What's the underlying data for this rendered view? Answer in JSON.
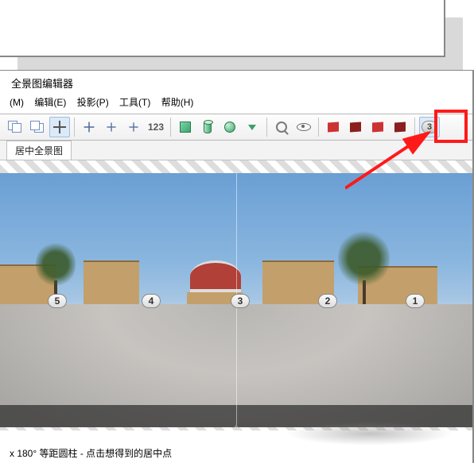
{
  "title": "全景图编辑器",
  "menu": {
    "m0": "(M)",
    "m1": "编辑(E)",
    "m2": "投影(P)",
    "m3": "工具(T)",
    "m4": "帮助(H)"
  },
  "toolbar": {
    "numeric_label": "123",
    "marker_label": "3"
  },
  "tab": {
    "label": "居中全景图"
  },
  "markers": {
    "m1": "5",
    "m2": "4",
    "m3": "3",
    "m4": "2",
    "m5": "1"
  },
  "status_text": "x 180° 等距圆柱 - 点击想得到的居中点"
}
